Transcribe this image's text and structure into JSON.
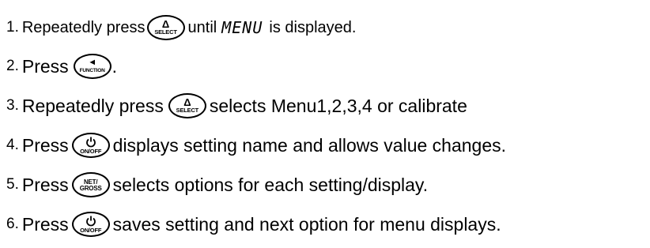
{
  "steps": [
    {
      "number": "1.",
      "text_before": "Repeatedly press",
      "button": {
        "glyph": "Δ",
        "label": "SELECT"
      },
      "lcd_text": "MENU",
      "text_after": "is displayed."
    },
    {
      "number": "2.",
      "text_before": "Press",
      "button": {
        "glyph": "◄",
        "label": "FUNCTION"
      },
      "text_after": "."
    },
    {
      "number": "3.",
      "text_before": "Repeatedly press",
      "button": {
        "glyph": "Δ",
        "label": "SELECT"
      },
      "text_after": "selects Menu1,2,3,4 or calibrate"
    },
    {
      "number": "4.",
      "text_before": "Press",
      "button": {
        "glyph": "power",
        "label": "ON/OFF"
      },
      "text_after": "displays setting name and allows value changes."
    },
    {
      "number": "5.",
      "text_before": "Press",
      "button": {
        "label": "NET/ GROSS",
        "label_line1": "NET/",
        "label_line2": "GROSS"
      },
      "text_after": "selects options for each setting/display."
    },
    {
      "number": "6.",
      "text_before": "Press",
      "button": {
        "glyph": "power",
        "label": "ON/OFF"
      },
      "text_after": "saves setting and next option for menu displays."
    }
  ],
  "step1_until": "until"
}
